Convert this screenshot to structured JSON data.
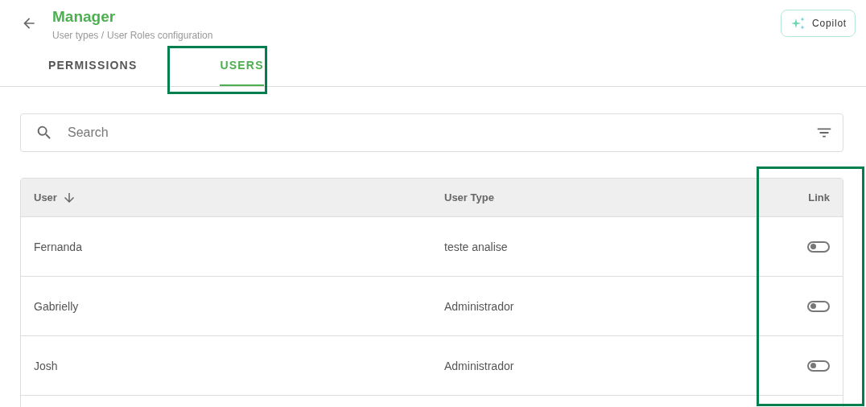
{
  "header": {
    "title": "Manager",
    "breadcrumb": [
      "User types /",
      "User Roles configuration"
    ],
    "copilot_button": "Copilot"
  },
  "tabs": [
    {
      "label": "PERMISSIONS",
      "selected": false
    },
    {
      "label": "USERS",
      "selected": true
    }
  ],
  "search": {
    "placeholder": "Search"
  },
  "table": {
    "columns": [
      {
        "label": "User",
        "sorted": true
      },
      {
        "label": "User Type",
        "sorted": false
      },
      {
        "label": "Link",
        "sorted": false
      }
    ],
    "rows": [
      {
        "user": "Fernanda",
        "user_type": "teste analise",
        "on": false
      },
      {
        "user": "Gabrielly",
        "user_type": "Administrador",
        "on": false
      },
      {
        "user": "Josh",
        "user_type": "Administrador",
        "on": false
      }
    ]
  }
}
